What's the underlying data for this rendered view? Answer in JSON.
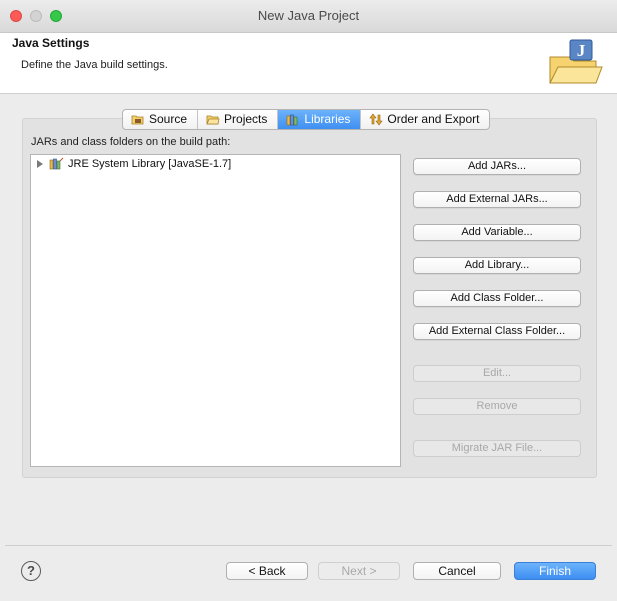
{
  "window": {
    "title": "New Java Project"
  },
  "header": {
    "title": "Java Settings",
    "description": "Define the Java build settings."
  },
  "tabs": [
    {
      "label": "Source",
      "icon": "source-folder-icon",
      "active": false
    },
    {
      "label": "Projects",
      "icon": "projects-folder-icon",
      "active": false
    },
    {
      "label": "Libraries",
      "icon": "libraries-icon",
      "active": true
    },
    {
      "label": "Order and Export",
      "icon": "order-export-icon",
      "active": false
    }
  ],
  "libraries": {
    "section_label": "JARs and class folders on the build path:",
    "tree": [
      {
        "label": "JRE System Library [JavaSE-1.7]",
        "icon": "jre-library-icon",
        "expanded": false
      }
    ],
    "buttons": {
      "add_jars": "Add JARs...",
      "add_external_jars": "Add External JARs...",
      "add_variable": "Add Variable...",
      "add_library": "Add Library...",
      "add_class_folder": "Add Class Folder...",
      "add_external_class_folder": "Add External Class Folder...",
      "edit": "Edit...",
      "remove": "Remove",
      "migrate_jar": "Migrate JAR File..."
    }
  },
  "footer": {
    "help_symbol": "?",
    "back": "< Back",
    "next": "Next >",
    "cancel": "Cancel",
    "finish": "Finish"
  },
  "colors": {
    "accent": "#3f8ff2",
    "close": "#fc5b57",
    "maximize": "#34c748"
  }
}
